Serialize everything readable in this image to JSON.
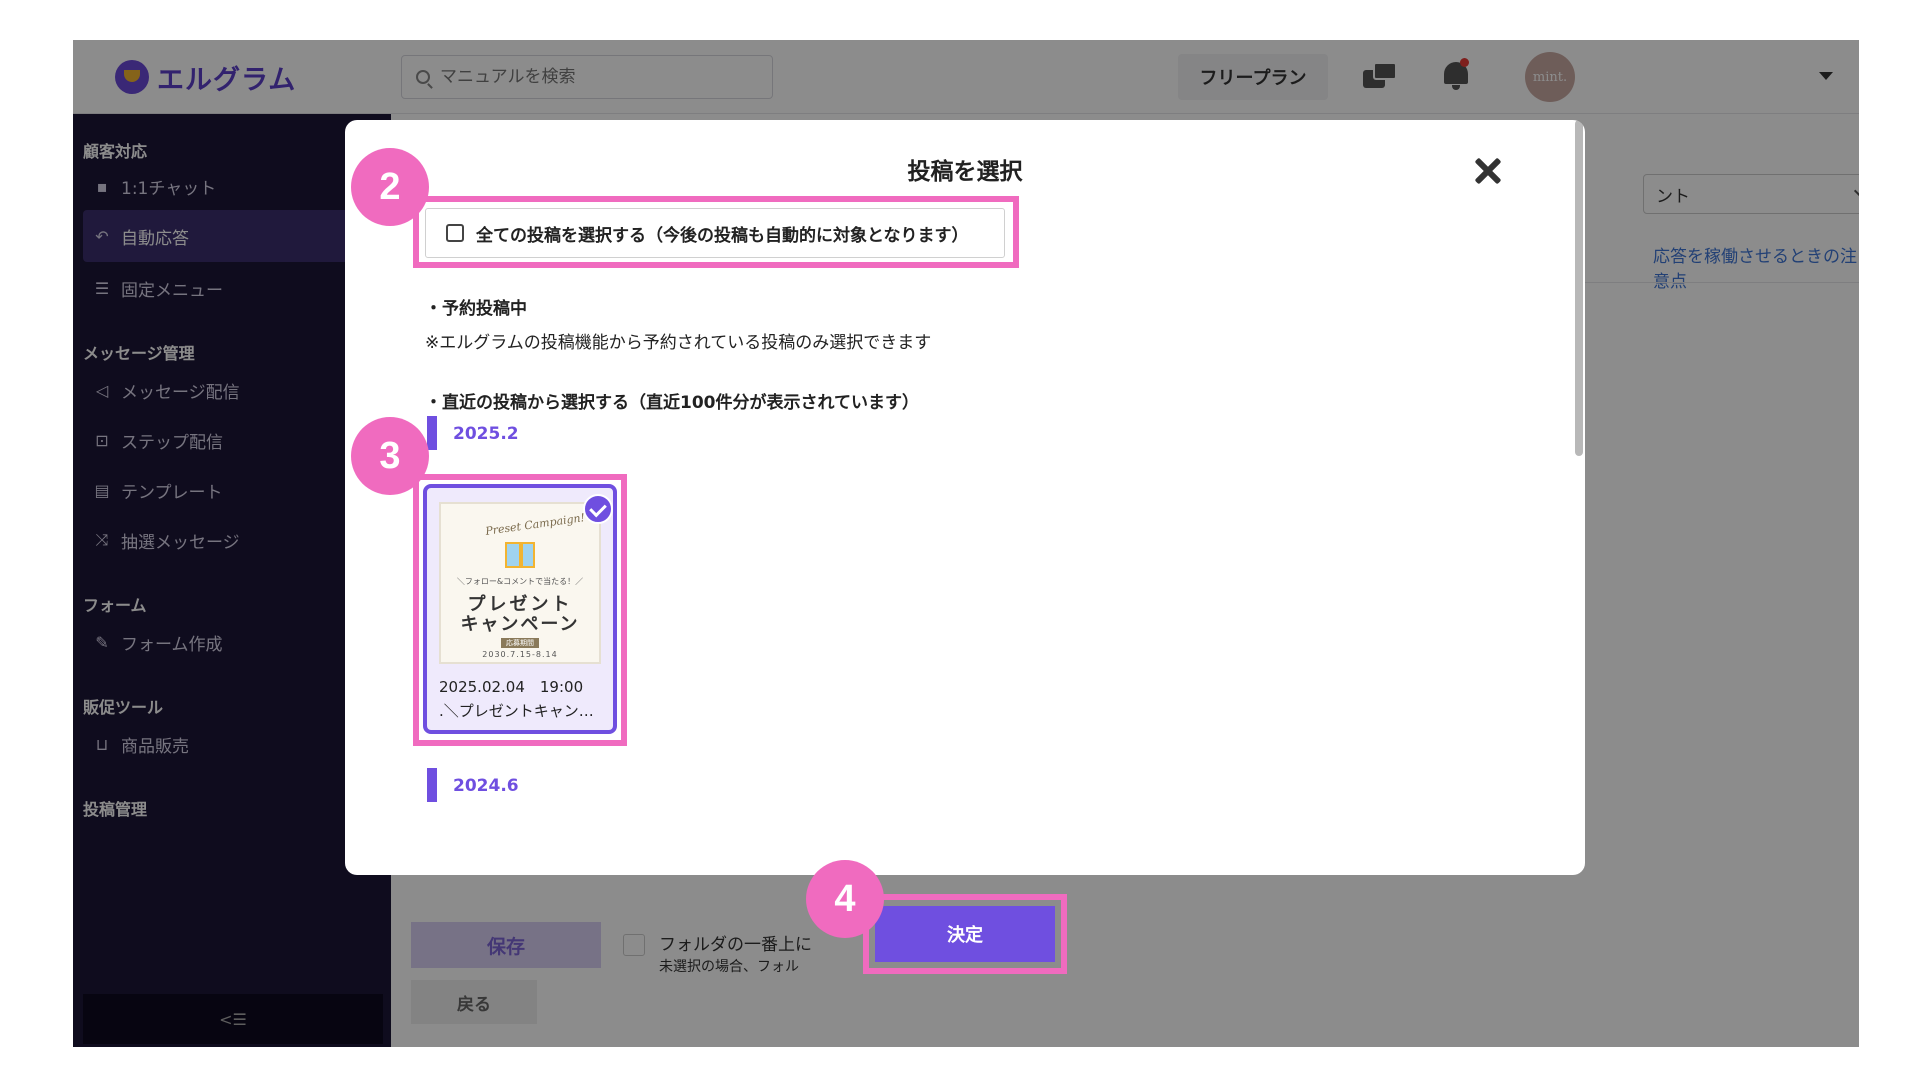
{
  "header": {
    "logo_text": "エルグラム",
    "search_placeholder": "マニュアルを検索",
    "plan_label": "フリープラン",
    "avatar_text": "mint."
  },
  "sidebar": {
    "sections": [
      {
        "title": "顧客対応",
        "items": [
          {
            "label": "1:1チャット",
            "icon": "chat-icon"
          },
          {
            "label": "自動応答",
            "icon": "reply-icon",
            "active": true
          },
          {
            "label": "固定メニュー",
            "icon": "menu-icon"
          }
        ]
      },
      {
        "title": "メッセージ管理",
        "items": [
          {
            "label": "メッセージ配信",
            "icon": "send-icon"
          },
          {
            "label": "ステップ配信",
            "icon": "step-icon"
          },
          {
            "label": "テンプレート",
            "icon": "template-icon"
          },
          {
            "label": "抽選メッセージ",
            "icon": "shuffle-icon"
          }
        ]
      },
      {
        "title": "フォーム",
        "items": [
          {
            "label": "フォーム作成",
            "icon": "form-icon"
          }
        ]
      },
      {
        "title": "販促ツール",
        "items": [
          {
            "label": "商品販売",
            "icon": "cart-icon"
          }
        ]
      },
      {
        "title": "投稿管理",
        "items": []
      }
    ],
    "collapse_label": "<☰"
  },
  "main": {
    "select_value": "ント",
    "notice_link": "応答を稼働させるときの注意点",
    "save_label": "保存",
    "back_label": "戻る",
    "folder_label": "フォルダの一番上に",
    "folder_note": "未選択の場合、フォル"
  },
  "modal": {
    "title": "投稿を選択",
    "select_all_label": "全ての投稿を選択する（今後の投稿も自動的に対象となります）",
    "scheduled_heading": "・予約投稿中",
    "scheduled_note": "※エルグラムの投稿機能から予約されている投稿のみ選択できます",
    "recent_heading": "・直近の投稿から選択する（直近100件分が表示されています）",
    "months": [
      "2025.2",
      "2024.6"
    ],
    "post": {
      "date": "2025.02.04　19:00",
      "caption": ".＼プレゼントキャンペーン",
      "selected": true,
      "thumb_script": "Preset Campaign!",
      "thumb_small": "＼フォロー&コメントで当たる！／",
      "thumb_line1": "プレゼント",
      "thumb_line2": "キャンペーン",
      "thumb_tag": "応募期間",
      "thumb_dates": "2030.7.15-8.14"
    },
    "confirm_label": "決定"
  },
  "annotations": {
    "badges": [
      "2",
      "3",
      "4"
    ],
    "highlight_color": "#f06bbf"
  },
  "colors": {
    "accent": "#6f4fe0",
    "sidebar_bg": "#1d1638",
    "link": "#3f76d6"
  }
}
